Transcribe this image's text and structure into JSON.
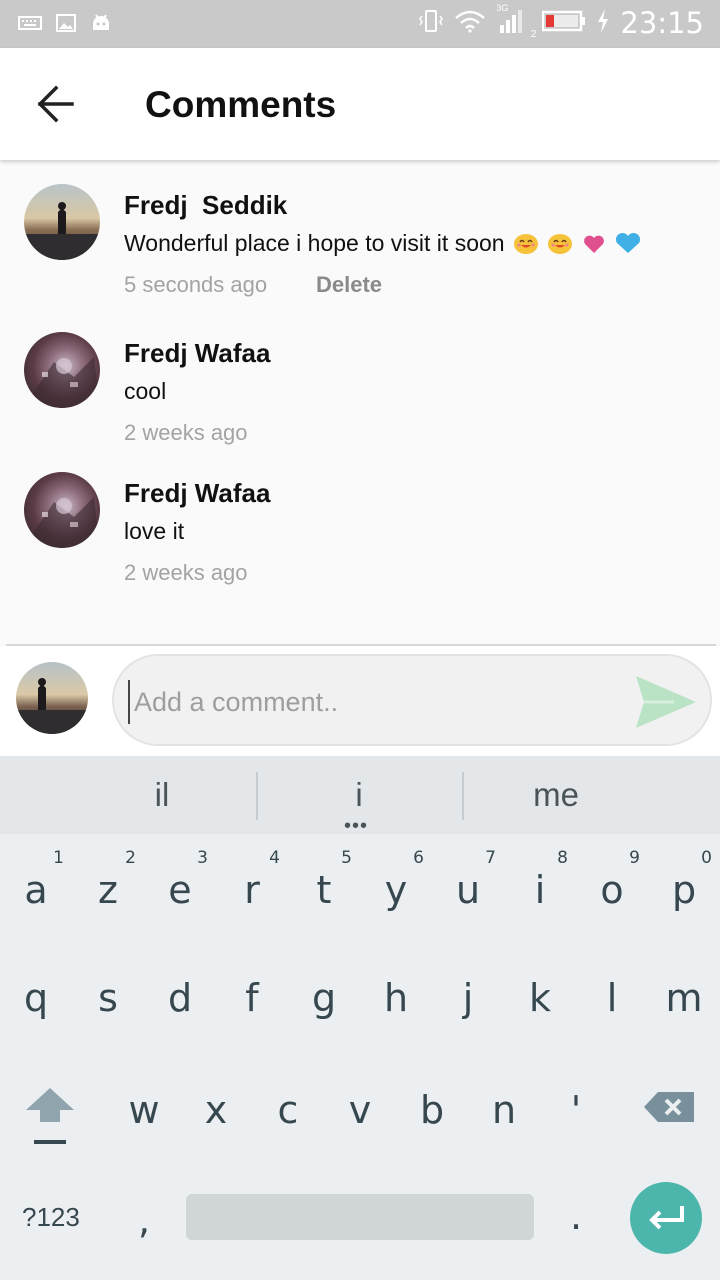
{
  "status_bar": {
    "time": "23:15",
    "network": "3G",
    "sim": "2"
  },
  "app_bar": {
    "title": "Comments"
  },
  "comments": [
    {
      "name": "Fredj  Seddik",
      "text": "Wonderful place i hope to visit it soon",
      "emojis": [
        "smiling-face-icon",
        "smiling-face-icon",
        "pink-heart-icon",
        "blue-heart-icon"
      ],
      "time": "5 seconds ago",
      "delete_label": "Delete"
    },
    {
      "name": "Fredj Wafaa",
      "text": "cool",
      "time": "2 weeks ago"
    },
    {
      "name": "Fredj Wafaa",
      "text": "love it",
      "time": "2 weeks ago"
    }
  ],
  "comment_input": {
    "placeholder": "Add a comment..",
    "value": ""
  },
  "colors": {
    "send_icon": "#b9e3c4",
    "enter_key": "#4db6ac",
    "status_bar": "#c9c9c9",
    "battery_low": "#e53935"
  },
  "keyboard": {
    "suggestions": [
      "il",
      "i",
      "me"
    ],
    "row1": [
      {
        "key": "a",
        "hint": "1"
      },
      {
        "key": "z",
        "hint": "2"
      },
      {
        "key": "e",
        "hint": "3"
      },
      {
        "key": "r",
        "hint": "4"
      },
      {
        "key": "t",
        "hint": "5"
      },
      {
        "key": "y",
        "hint": "6"
      },
      {
        "key": "u",
        "hint": "7"
      },
      {
        "key": "i",
        "hint": "8"
      },
      {
        "key": "o",
        "hint": "9"
      },
      {
        "key": "p",
        "hint": "0"
      }
    ],
    "row2": [
      "q",
      "s",
      "d",
      "f",
      "g",
      "h",
      "j",
      "k",
      "l",
      "m"
    ],
    "row3": [
      "w",
      "x",
      "c",
      "v",
      "b",
      "n",
      "'"
    ],
    "symbols_label": "?123",
    "comma": ",",
    "period": "."
  }
}
